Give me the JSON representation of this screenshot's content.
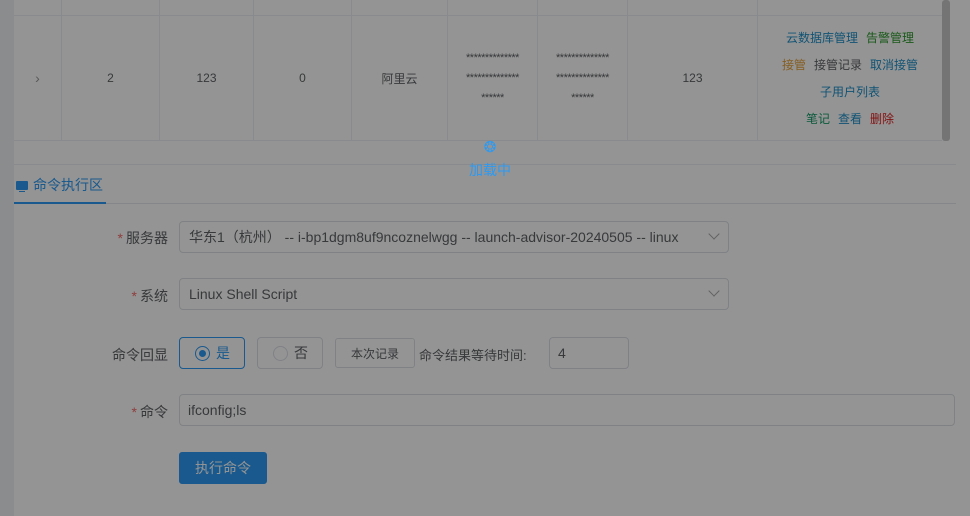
{
  "table": {
    "row_prev_ops": [
      "...",
      "...",
      "..."
    ],
    "row": {
      "index": "2",
      "col_a": "123",
      "col_b": "0",
      "provider": "阿里云",
      "key1": [
        "**************",
        "**************",
        "******"
      ],
      "key2": [
        "**************",
        "**************",
        "******"
      ],
      "col_c": "123"
    },
    "ops": {
      "cloud_db": "云数据库管理",
      "alarm": "告警管理",
      "takeover": "接管",
      "takeover_log": "接管记录",
      "cancel_takeover": "取消接管",
      "sub_users": "子用户列表",
      "notes": "笔记",
      "view": "查看",
      "delete": "删除"
    }
  },
  "loading_text": "加载中",
  "tab": {
    "label": "命令执行区"
  },
  "form": {
    "server_label": "服务器",
    "server_value": "华东1（杭州） -- i-bp1dgm8uf9ncoznelwgg -- launch-advisor-20240505 -- linux",
    "system_label": "系统",
    "system_value": "Linux Shell Script",
    "echo_label": "命令回显",
    "echo_yes": "是",
    "echo_no": "否",
    "record_button": "本次记录",
    "wait_label": "命令结果等待时间:",
    "wait_value": "4",
    "command_label": "命令",
    "command_value": "ifconfig;ls",
    "execute_button": "执行命令"
  },
  "colors": {
    "primary": "#2b9af3",
    "required": "#f56c6c",
    "overlay": "rgba(0,0,0,0.42)"
  }
}
